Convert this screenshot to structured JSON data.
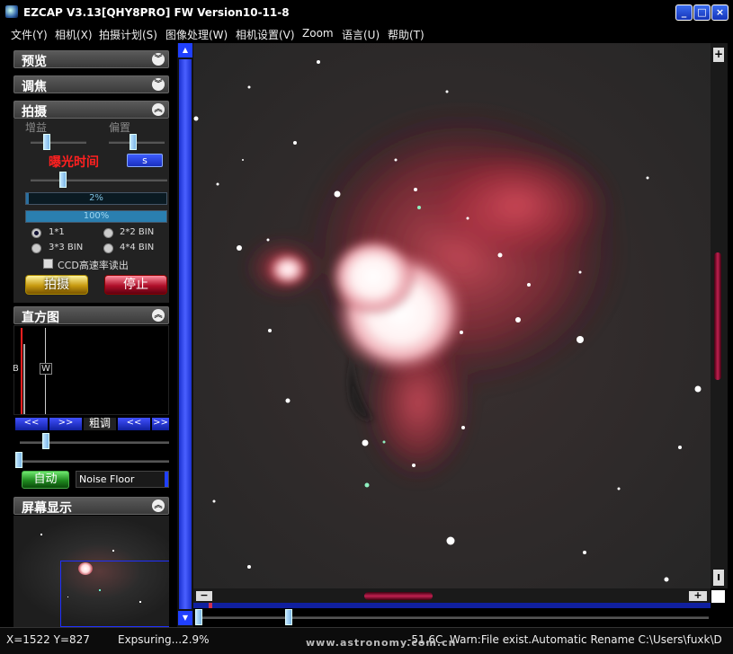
{
  "window": {
    "title": "EZCAP V3.13[QHY8PRO] FW Version10-11-8"
  },
  "menu": [
    "文件(Y)",
    "相机(X)",
    "拍摄计划(S)",
    "图像处理(W)",
    "相机设置(V)",
    "Zoom",
    "语言(U)",
    "帮助(T)"
  ],
  "sections": {
    "preview": "预览",
    "focus": "调焦",
    "capture": "拍摄",
    "histogram": "直方图",
    "display": "屏幕显示"
  },
  "capture": {
    "gain_label": "增益",
    "offset_label": "偏置",
    "exposure_label": "曝光时间",
    "unit_button": "s",
    "progress_text": "2%",
    "progress_value": 0.02,
    "download_text": "100%",
    "download_value": 1.0,
    "bin_options": [
      "1*1",
      "2*2 BIN",
      "3*3 BIN",
      "4*4 BIN"
    ],
    "selected_bin": "1*1",
    "ccd_checkbox": "CCD高速率读出",
    "start_button": "拍摄",
    "stop_button": "停止"
  },
  "histogram": {
    "b_marker": "B",
    "w_marker": "W",
    "nav_buttons": [
      "<<",
      ">>",
      "粗调",
      "<<",
      ">>"
    ],
    "auto_button": "自动",
    "mode_select": "Noise Floor"
  },
  "status": {
    "coords": "X=1522 Y=827",
    "exposing": "Expsuring...2.9%",
    "temperature": "-51.6C",
    "message": "Warn:File exist.Automatic Rename C:\\Users\\fuxk\\D"
  },
  "watermark": "www.astronomy.com.cn",
  "colors": {
    "accent_blue": "#1e3fd0",
    "exposure_red": "#ff2020",
    "stop_red": "#b0102a"
  }
}
